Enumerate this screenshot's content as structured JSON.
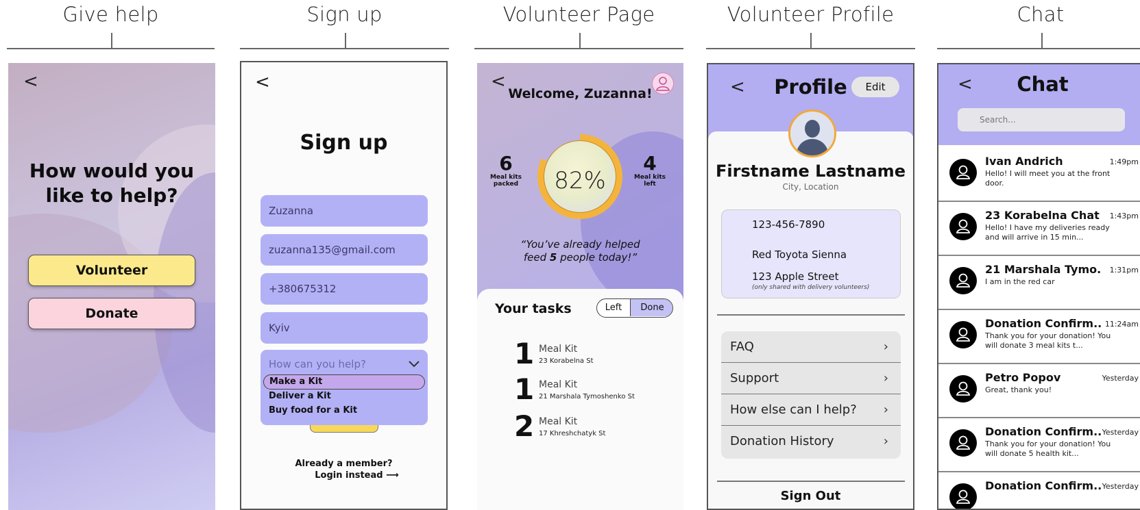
{
  "headers": {
    "give_help": "Give help",
    "sign_up": "Sign up",
    "volunteer_page": "Volunteer Page",
    "volunteer_profile": "Volunteer Profile",
    "chat": "Chat"
  },
  "give_help": {
    "back": "<",
    "question": "How would you like to help?",
    "volunteer_label": "Volunteer",
    "donate_label": "Donate",
    "colors": {
      "volunteer": "#fbe98b",
      "donate": "#fbd4de"
    }
  },
  "sign_up": {
    "back": "<",
    "title": "Sign up",
    "fields": {
      "name": "Zuzanna",
      "email": "zuzanna135@gmail.com",
      "phone": "+380675312",
      "city": "Kyiv"
    },
    "dropdown": {
      "placeholder": "How can you help?",
      "caret": "⌄",
      "options": [
        "Make a Kit",
        "Deliver a Kit",
        "Buy food for a Kit"
      ],
      "selected": "Make a Kit"
    },
    "already_member": "Already a member?",
    "login_instead": "Login instead ⟶"
  },
  "volunteer_page": {
    "back": "<",
    "welcome": "Welcome, Zuzanna!",
    "packed": {
      "value": "6",
      "label_line1": "Meal kits",
      "label_line2": "packed"
    },
    "left": {
      "value": "4",
      "label_line1": "Meal kits",
      "label_line2": "left"
    },
    "progress_percent": "82%",
    "progress_value": 82,
    "quote_line1": "“You’ve already helped",
    "quote_pre": "feed ",
    "quote_count": "5",
    "quote_post": " people today!”",
    "tasks_title": "Your tasks",
    "toggle": {
      "left": "Left",
      "done": "Done"
    },
    "tasks": [
      {
        "qty": "1",
        "title": "Meal Kit",
        "address": "23 Korabelna St"
      },
      {
        "qty": "1",
        "title": "Meal Kit",
        "address": "21 Marshala Tymoshenko St"
      },
      {
        "qty": "2",
        "title": "Meal Kit",
        "address": "17 Khreshchatyk St"
      }
    ]
  },
  "profile": {
    "back": "<",
    "title": "Profile",
    "edit": "Edit",
    "name": "Firstname Lastname",
    "location": "City, Location",
    "phone": "123-456-7890",
    "car": "Red Toyota Sienna",
    "address": "123 Apple Street",
    "address_note": "(only shared with delivery volunteers)",
    "menu": [
      {
        "label": "FAQ",
        "arrow": "›"
      },
      {
        "label": "Support",
        "arrow": "›"
      },
      {
        "label": "How else can I help?",
        "arrow": "›"
      },
      {
        "label": "Donation History",
        "arrow": "›"
      }
    ],
    "sign_out": "Sign Out"
  },
  "chat": {
    "back": "<",
    "title": "Chat",
    "search_placeholder": "Search...",
    "items": [
      {
        "name": "Ivan Andrich",
        "time": "1:49pm",
        "message": "Hello! I will meet you at the front door."
      },
      {
        "name": "23 Korabelna Chat",
        "time": "1:43pm",
        "message": "Hello! I have my deliveries ready and will arrive in 15 min..."
      },
      {
        "name": "21 Marshala Tymo...",
        "time": "1:31pm",
        "message": "I am in the red car"
      },
      {
        "name": "Donation Confirm...",
        "time": "11:24am",
        "message": "Thank you for your donation! You will donate 3 meal kits t..."
      },
      {
        "name": "Petro Popov",
        "time": "Yesterday",
        "message": "Great, thank you!"
      },
      {
        "name": "Donation Confirm...",
        "time": "Yesterday",
        "message": "Thank you for your donation! You will donate 5 health kit..."
      },
      {
        "name": "Donation Confirm...",
        "time": "Yesterday",
        "message": ""
      }
    ]
  }
}
